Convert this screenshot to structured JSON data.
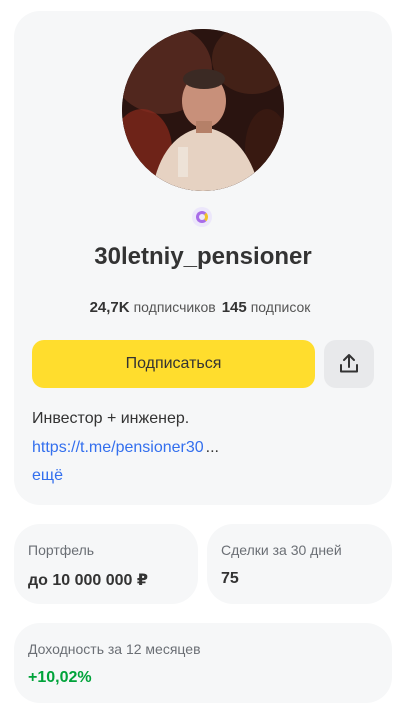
{
  "profile": {
    "username": "30letniy_pensioner",
    "followers_count": "24,7K",
    "followers_label": "подписчиков",
    "following_count": "145",
    "following_label": "подписок",
    "subscribe_label": "Подписаться",
    "bio_text": "Инвестор + инженер.",
    "bio_link": "https://t.me/pensioner30",
    "bio_ellipsis": "...",
    "more_label": "ещё"
  },
  "portfolio": {
    "title": "Портфель",
    "value": "до 10 000 000 ₽"
  },
  "deals": {
    "title": "Сделки за 30 дней",
    "value": "75"
  },
  "yield": {
    "title": "Доходность за 12 месяцев",
    "value": "+10,02%"
  },
  "colors": {
    "accent_yellow": "#ffdd2d",
    "link_blue": "#336fee",
    "positive_green": "#00a33a",
    "card_bg": "#f6f7f8"
  },
  "icons": {
    "badge": "verified-badge-icon",
    "share": "share-icon"
  }
}
